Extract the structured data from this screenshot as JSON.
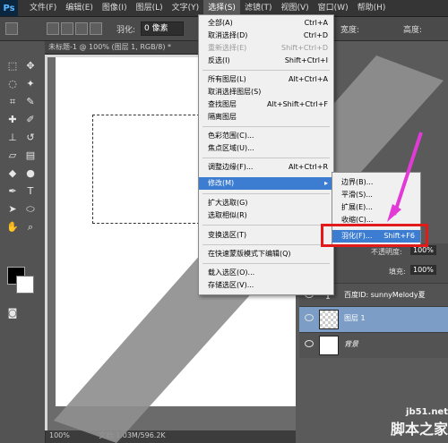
{
  "menubar": {
    "logo": "Ps",
    "items": [
      "文件(F)",
      "编辑(E)",
      "图像(I)",
      "图层(L)",
      "文字(Y)",
      "选择(S)",
      "滤镜(T)",
      "视图(V)",
      "窗口(W)",
      "帮助(H)"
    ],
    "active": "选择(S)"
  },
  "options": {
    "feather_label": "羽化:",
    "feather_value": "0 像素",
    "width_label": "宽度:",
    "height_label": "高度:"
  },
  "document": {
    "tab": "未标题-1 @ 100% (图层 1, RGB/8) *",
    "zoom": "100%",
    "doc_info": "文档:1.03M/596.2K"
  },
  "select_menu": {
    "items": [
      {
        "label": "全部(A)",
        "shortcut": "Ctrl+A"
      },
      {
        "label": "取消选择(D)",
        "shortcut": "Ctrl+D"
      },
      {
        "label": "重新选择(E)",
        "shortcut": "Shift+Ctrl+D"
      },
      {
        "label": "反选(I)",
        "shortcut": "Shift+Ctrl+I"
      },
      {
        "label": "所有图层(L)",
        "shortcut": "Alt+Ctrl+A"
      },
      {
        "label": "取消选择图层(S)",
        "shortcut": ""
      },
      {
        "label": "查找图层",
        "shortcut": "Alt+Shift+Ctrl+F"
      },
      {
        "label": "隔离图层",
        "shortcut": ""
      },
      {
        "label": "色彩范围(C)...",
        "shortcut": ""
      },
      {
        "label": "焦点区域(U)...",
        "shortcut": ""
      },
      {
        "label": "调整边缘(F)...",
        "shortcut": "Alt+Ctrl+R"
      },
      {
        "label": "修改(M)",
        "shortcut": ""
      },
      {
        "label": "扩大选取(G)",
        "shortcut": ""
      },
      {
        "label": "选取相似(R)",
        "shortcut": ""
      },
      {
        "label": "变换选区(T)",
        "shortcut": ""
      },
      {
        "label": "在快速蒙版模式下编辑(Q)",
        "shortcut": ""
      },
      {
        "label": "载入选区(O)...",
        "shortcut": ""
      },
      {
        "label": "存储选区(V)...",
        "shortcut": ""
      }
    ]
  },
  "modify_submenu": {
    "items": [
      {
        "label": "边界(B)...",
        "shortcut": ""
      },
      {
        "label": "平滑(S)...",
        "shortcut": ""
      },
      {
        "label": "扩展(E)...",
        "shortcut": ""
      },
      {
        "label": "收缩(C)...",
        "shortcut": ""
      },
      {
        "label": "羽化(F)...",
        "shortcut": "Shift+F6"
      }
    ]
  },
  "layers_panel": {
    "opacity_label": "不透明度:",
    "opacity_value": "100%",
    "fill_label": "填充:",
    "fill_value": "100%",
    "layers": [
      {
        "name": "百度ID: sunnyMelody夏"
      },
      {
        "name": "图层 1"
      },
      {
        "name": "背景"
      }
    ]
  },
  "watermark": {
    "line1": "jb51.net",
    "line2": "脚本之家"
  },
  "colors": {
    "highlight": "#3d7dd1",
    "annotation_red": "#e21a1a",
    "annotation_arrow": "#e23ad6"
  }
}
